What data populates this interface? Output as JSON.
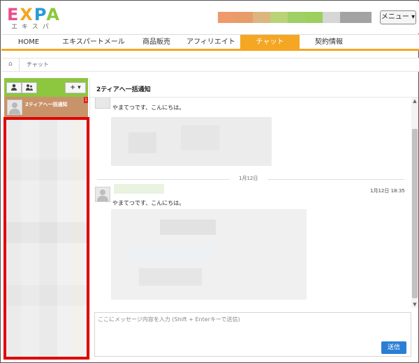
{
  "logo": {
    "text": "EXPA",
    "letters": [
      "E",
      "X",
      "P",
      "A"
    ],
    "letter_colors": [
      "#e94e8c",
      "#f5a623",
      "#2a9ad6",
      "#8dc63f"
    ],
    "subtext": "エキスパ"
  },
  "header": {
    "color_strip": [
      "#ee9a6d",
      "#e89c6a",
      "#dcb57f",
      "#b9d377",
      "#9fcf65",
      "#9ccf5e",
      "#d6d6d6",
      "#a3a3a3"
    ],
    "menu_label": "メニュー ▾"
  },
  "nav": {
    "tabs": [
      {
        "label": "HOME",
        "active": false
      },
      {
        "label": "エキスパートメール",
        "active": false
      },
      {
        "label": "商品販売",
        "active": false
      },
      {
        "label": "アフィリエイト",
        "active": false
      },
      {
        "label": "チャット",
        "active": true
      },
      {
        "label": "契約情報",
        "active": false
      }
    ],
    "accent": "#f5a623"
  },
  "breadcrumb": {
    "home_icon": "home-icon",
    "current": "チャット"
  },
  "sidebar": {
    "toolbar_color": "#8dc63f",
    "single_user_icon": "single-user-icon",
    "group_icon": "group-icon",
    "add_label": "+ ▾",
    "contacts": [
      {
        "name": "2ティアへ一括通知",
        "badge": "1"
      }
    ],
    "highlight_color": "#e00000"
  },
  "chat": {
    "title": "2ティアへ一括通知",
    "messages": [
      {
        "text": "やまてつです、こんにちは。"
      }
    ],
    "date_divider": "1月12日",
    "second_message": {
      "time": "1月12日 18:35",
      "text": "やまてつです、こんにちは。"
    },
    "input_placeholder": "ここにメッセージ内容を入力 (Shift + Enterキーで送信)",
    "send_label": "送信",
    "send_color": "#2a7fd4"
  }
}
